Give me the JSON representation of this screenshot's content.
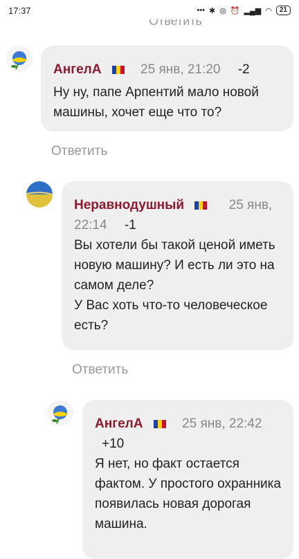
{
  "status_bar": {
    "time": "17:37",
    "battery": "21",
    "icons": [
      "more-dots-icon",
      "bluetooth-icon",
      "hd-icon",
      "alarm-icon",
      "signal-icon",
      "wifi-icon",
      "battery-icon"
    ]
  },
  "cut_reply": "Ответить",
  "comments": [
    {
      "author": "АнгелА",
      "date": "25 янв, 21:20",
      "score": "-2",
      "text": "Ну ну, папе Арпентий мало новой машины, хочет еще что то?",
      "reply": "Ответить",
      "avatar": "rose-avatar"
    },
    {
      "author": "Неравнодушный",
      "date": "25 янв,\n22:14",
      "score": "-1",
      "text": "Вы хотели бы такой ценой иметь новую машину? И есть ли это на самом деле?\nУ Вас хоть что-то человеческое есть?",
      "reply": "Ответить",
      "avatar": "field-avatar"
    },
    {
      "author": "АнгелА",
      "date": "25 янв, 22:42",
      "score": "+10",
      "text": "Я нет, но факт остается фактом. У простого охранника появилась новая дорогая машина.",
      "avatar": "rose-avatar"
    }
  ],
  "colors": {
    "author": "#8a1a2e",
    "bubble": "#efefef",
    "muted": "#888888"
  }
}
